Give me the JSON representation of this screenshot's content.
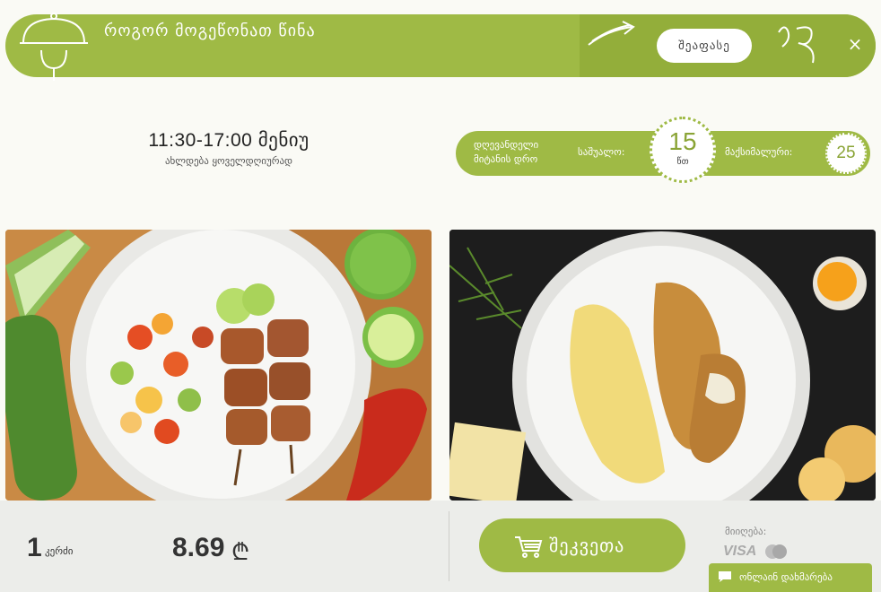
{
  "banner": {
    "title": "როგორ მოგეწონათ წინა",
    "rate_button": "შეაფასე",
    "close": "×",
    "icons": [
      "cloche-icon",
      "arrow-icon",
      "squiggle-icon",
      "close-icon"
    ]
  },
  "hours": {
    "time": "11:30-17:00 მენიუ",
    "subtitle": "ახლდება ყოველდღიურად"
  },
  "delivery": {
    "label": "დღევანდელი მიტანის დრო",
    "avg_label": "საშუალო:",
    "avg_value": "15",
    "avg_unit": "წთ",
    "max_label": "მაქსიმალური:",
    "max_value": "25"
  },
  "photos": {
    "left": "grilled-chicken-skewers-with-vegetables",
    "right": "breaded-chicken-with-mashed-potatoes"
  },
  "order": {
    "quantity": "1",
    "quantity_unit": "კერძი",
    "price": "8.69",
    "currency": "₾",
    "order_button": "შეკვეთა",
    "accept_label": "მიიღება:",
    "visa": "VISA"
  },
  "chat": {
    "label": "ონლაინ დახმარება"
  },
  "colors": {
    "accent": "#9fba45",
    "background": "#fafaf5",
    "bottom_bar": "#ecedea"
  }
}
